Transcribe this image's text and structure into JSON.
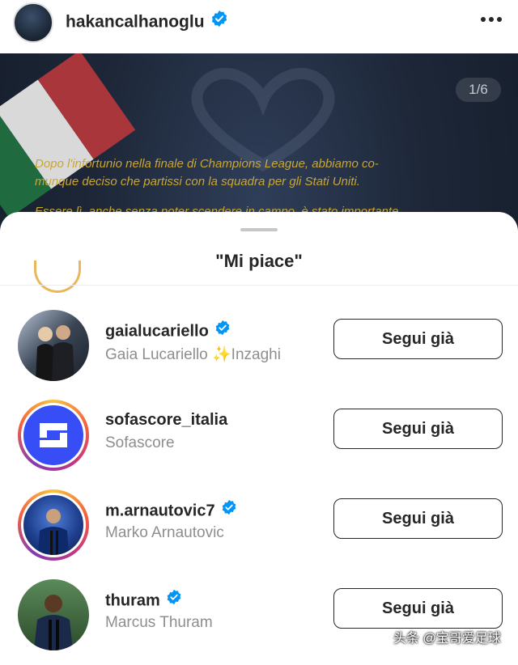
{
  "header": {
    "username": "hakancalhanoglu",
    "verified": true,
    "more_icon": "more-horizontal-icon"
  },
  "post": {
    "page_counter": "1/6",
    "caption_lines": [
      "Dopo l'infortunio nella finale di Champions League, abbiamo co-",
      "munque deciso che partissi con la squadra per gli Stati Uniti.",
      "Essere lì, anche senza poter scendere in campo, è stato importante"
    ]
  },
  "likes_sheet": {
    "title": "\"Mi piace\"",
    "users": [
      {
        "username": "gaialucariello",
        "verified": true,
        "full_name": "Gaia Lucariello ✨Inzaghi",
        "button": "Segui già",
        "story_ring": false
      },
      {
        "username": "sofascore_italia",
        "verified": false,
        "full_name": "Sofascore",
        "button": "Segui già",
        "story_ring": true
      },
      {
        "username": "m.arnautovic7",
        "verified": true,
        "full_name": "Marko Arnautovic",
        "button": "Segui già",
        "story_ring": true
      },
      {
        "username": "thuram",
        "verified": true,
        "full_name": "Marcus Thuram",
        "button": "Segui già",
        "story_ring": false
      }
    ]
  },
  "watermark": "头条 @宝哥爱足球",
  "colors": {
    "verified_blue": "#0095f6",
    "sofascore_blue": "#374df5",
    "caption_gold": "#c9a635"
  }
}
